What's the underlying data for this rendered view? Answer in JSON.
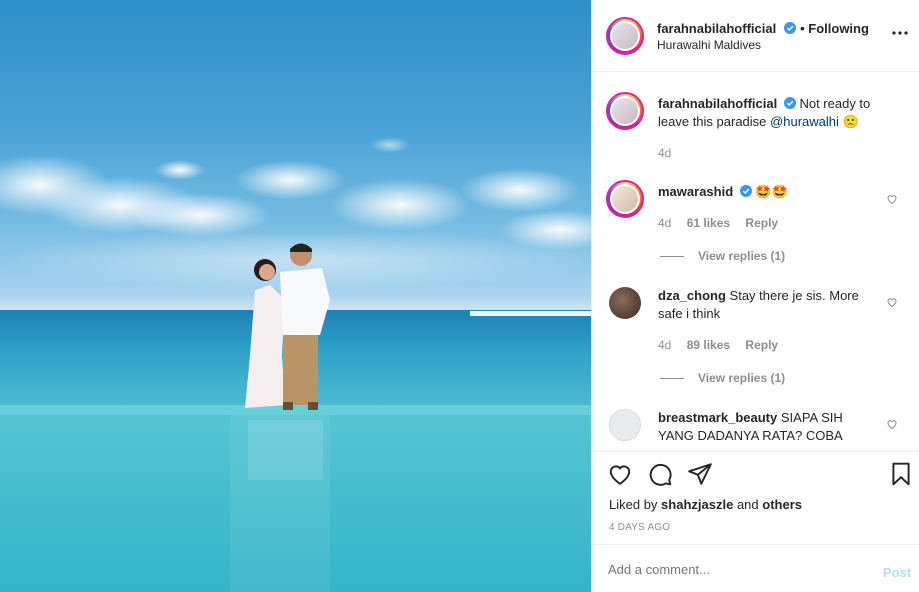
{
  "post": {
    "author": "farahnabilahofficial",
    "follow_status": "• Following",
    "location": "Hurawalhi Maldives",
    "more_icon": "more-dots-icon"
  },
  "caption": {
    "author": "farahnabilahofficial",
    "text_line1": "Not ready to",
    "text_line2": "leave this paradise",
    "mention": "@hurawalhi",
    "emoji": "🙁",
    "time": "4d"
  },
  "comments": [
    {
      "user": "mawarashid",
      "text": "🤩🤩",
      "time": "4d",
      "likes": "61 likes",
      "reply": "Reply",
      "view_replies": "View replies (1)",
      "verified": true
    },
    {
      "user": "dza_chong",
      "text_line1": "Stay there je sis. More",
      "text_line2": "safe i think",
      "time": "4d",
      "likes": "89 likes",
      "reply": "Reply",
      "view_replies": "View replies (1)"
    },
    {
      "user": "breastmark_beauty",
      "text_line1": "SIAPA SIH",
      "text_line2": "YANG DADANYA RATA? COBA"
    }
  ],
  "actions": {
    "liked_by_prefix": "Liked by",
    "liked_by_user": "shahzjaszle",
    "liked_by_and": "and",
    "liked_by_others": "others",
    "date": "4 DAYS AGO"
  },
  "composer": {
    "placeholder": "Add a comment...",
    "post_label": "Post"
  },
  "colors": {
    "verified": "#3897f0",
    "link": "#00376b",
    "post_disabled": "#b2dffc"
  }
}
